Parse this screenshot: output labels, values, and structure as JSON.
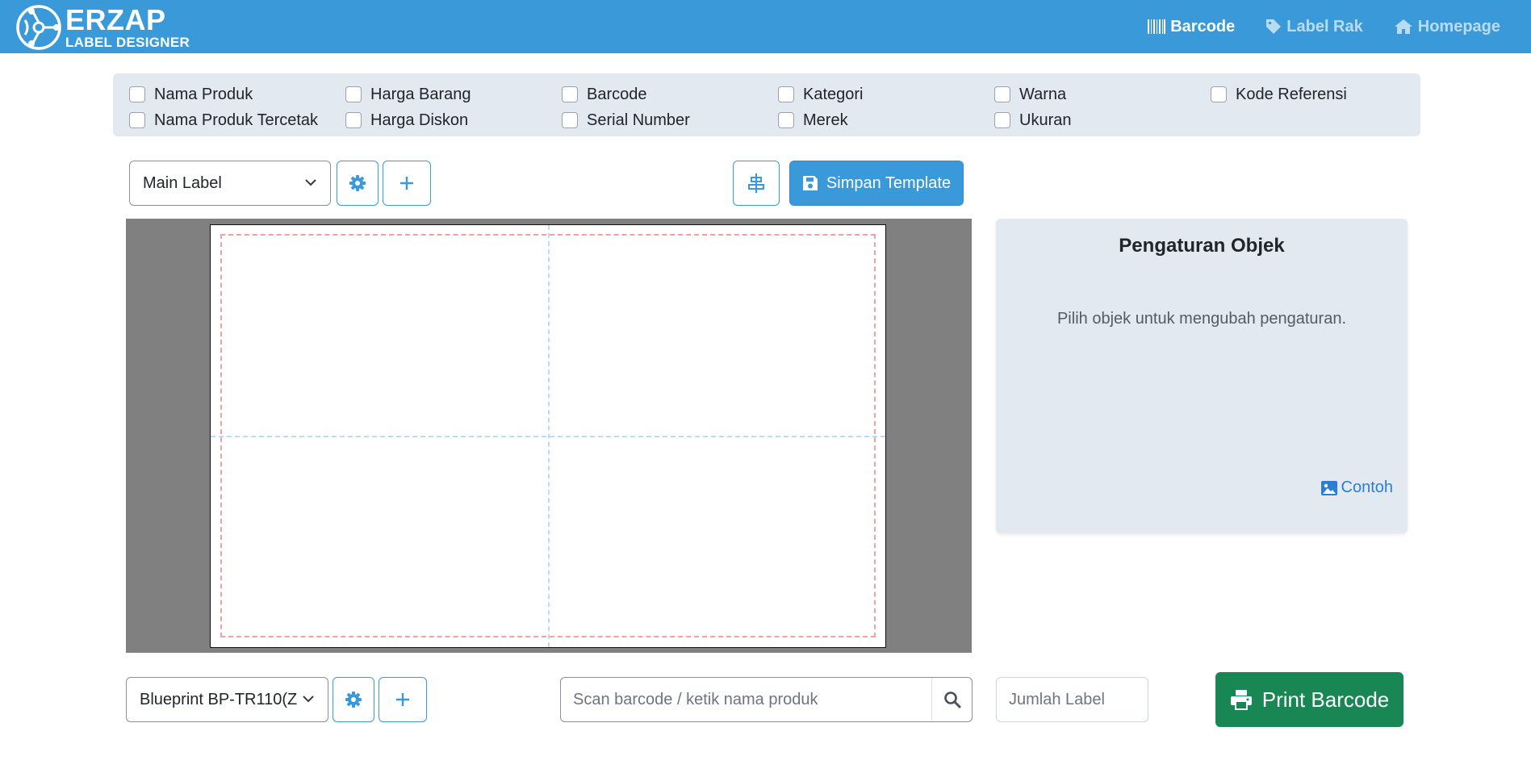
{
  "header": {
    "logo_title": "ERZAP",
    "logo_subtitle": "LABEL DESIGNER",
    "nav": [
      {
        "label": "Barcode",
        "icon": "barcode-icon",
        "active": true
      },
      {
        "label": "Label Rak",
        "icon": "tag-icon",
        "active": false
      },
      {
        "label": "Homepage",
        "icon": "home-icon",
        "active": false
      }
    ]
  },
  "fields": {
    "columns": [
      [
        "Nama Produk",
        "Nama Produk Tercetak"
      ],
      [
        "Harga Barang",
        "Harga Diskon"
      ],
      [
        "Barcode",
        "Serial Number"
      ],
      [
        "Kategori",
        "Merek"
      ],
      [
        "Warna",
        "Ukuran"
      ],
      [
        "Kode Referensi"
      ]
    ]
  },
  "toolbar": {
    "label_select": "Main Label",
    "save_label": "Simpan Template"
  },
  "settings_panel": {
    "title": "Pengaturan Objek",
    "hint": "Pilih objek untuk mengubah pengaturan.",
    "example_link": "Contoh"
  },
  "bottom": {
    "printer_select": "Blueprint BP-TR110(Z",
    "search_placeholder": "Scan barcode / ketik nama produk",
    "qty_placeholder": "Jumlah Label",
    "print_label": "Print Barcode"
  },
  "colors": {
    "header": "#3a9ad9",
    "primary": "#3a9ad9",
    "success": "#198754",
    "panel": "#e3e9f1",
    "canvas_bg": "#808080",
    "margin_guide": "#f3a0a0",
    "center_guide": "#b8ddf5"
  }
}
